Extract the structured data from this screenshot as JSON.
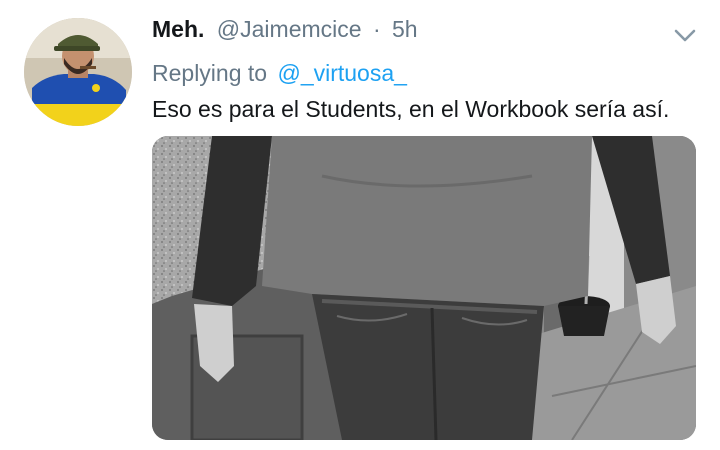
{
  "tweet": {
    "author_name": "Meh.",
    "author_handle": "@Jaimemcice",
    "separator": "·",
    "timestamp": "5h",
    "replying_prefix": "Replying to",
    "replying_to": "@_virtuosa_",
    "text": "Eso es para el Students, en el Workbook sería así."
  },
  "icons": {
    "menu": "chevron-down-icon"
  },
  "colors": {
    "link": "#1da1f2",
    "secondary_text": "#657786",
    "primary_text": "#14171a"
  }
}
